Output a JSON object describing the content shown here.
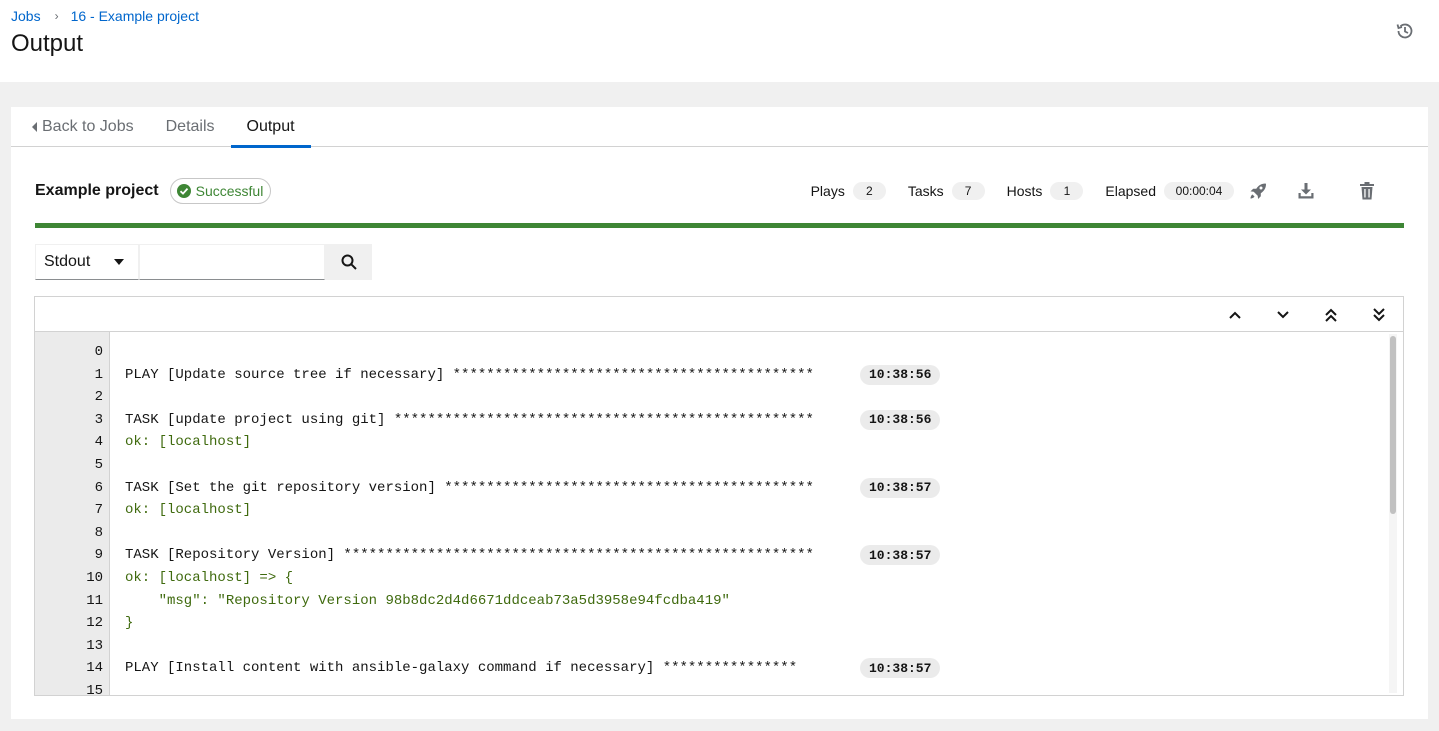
{
  "breadcrumb": {
    "jobs": "Jobs",
    "job": "16 - Example project"
  },
  "page": {
    "title": "Output"
  },
  "tabs": {
    "back": "Back to Jobs",
    "details": "Details",
    "output": "Output"
  },
  "job": {
    "name": "Example project",
    "status": "Successful",
    "plays_label": "Plays",
    "plays": "2",
    "tasks_label": "Tasks",
    "tasks": "7",
    "hosts_label": "Hosts",
    "hosts": "1",
    "elapsed_label": "Elapsed",
    "elapsed": "00:00:04",
    "progress": 1.0
  },
  "search": {
    "filter": "Stdout",
    "value": ""
  },
  "colors": {
    "accent": "#0066cc",
    "success": "#3e8635",
    "ok_text": "#3f6a0e"
  },
  "lines": [
    {
      "num": "0",
      "text": "",
      "ok": false,
      "ts": ""
    },
    {
      "num": "1",
      "text": "PLAY [Update source tree if necessary] *******************************************",
      "ok": false,
      "ts": "10:38:56"
    },
    {
      "num": "2",
      "text": "",
      "ok": false,
      "ts": ""
    },
    {
      "num": "3",
      "text": "TASK [update project using git] **************************************************",
      "ok": false,
      "ts": "10:38:56"
    },
    {
      "num": "4",
      "text": "ok: [localhost]",
      "ok": true,
      "ts": ""
    },
    {
      "num": "5",
      "text": "",
      "ok": false,
      "ts": ""
    },
    {
      "num": "6",
      "text": "TASK [Set the git repository version] ********************************************",
      "ok": false,
      "ts": "10:38:57"
    },
    {
      "num": "7",
      "text": "ok: [localhost]",
      "ok": true,
      "ts": ""
    },
    {
      "num": "8",
      "text": "",
      "ok": false,
      "ts": ""
    },
    {
      "num": "9",
      "text": "TASK [Repository Version] ********************************************************",
      "ok": false,
      "ts": "10:38:57"
    },
    {
      "num": "10",
      "text": "ok: [localhost] => {",
      "ok": true,
      "ts": ""
    },
    {
      "num": "11",
      "text": "    \"msg\": \"Repository Version 98b8dc2d4d6671ddceab73a5d3958e94fcdba419\"",
      "ok": true,
      "ts": ""
    },
    {
      "num": "12",
      "text": "}",
      "ok": true,
      "ts": ""
    },
    {
      "num": "13",
      "text": "",
      "ok": false,
      "ts": ""
    },
    {
      "num": "14",
      "text": "PLAY [Install content with ansible-galaxy command if necessary] ****************",
      "ok": false,
      "ts": "10:38:57"
    },
    {
      "num": "15",
      "text": "",
      "ok": false,
      "ts": ""
    }
  ]
}
